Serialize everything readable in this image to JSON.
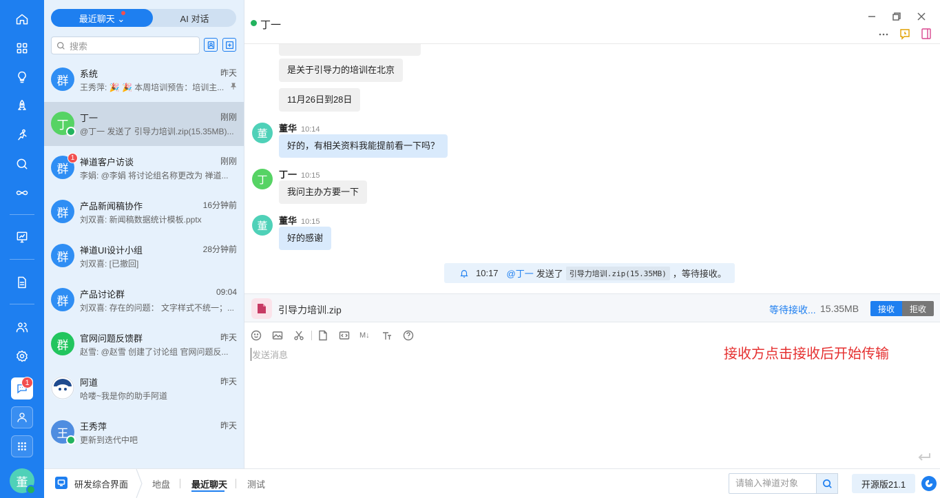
{
  "colors": {
    "brand": "#1e7ff0",
    "online": "#22b35e",
    "badge": "#f24f4f",
    "annotation": "#e53030"
  },
  "panel": {
    "tabs": [
      {
        "label": "最近聊天 ⌄"
      },
      {
        "label": "AI 对话"
      }
    ],
    "search_placeholder": "搜索",
    "sessions": [
      {
        "avatar": "群",
        "color": "#2f8ef4",
        "name": "系统",
        "time": "昨天",
        "snippet": "王秀萍: 🎉 🎉 本周培训预告：培训主...",
        "pinned": true
      },
      {
        "avatar": "丁",
        "color": "#56d364",
        "name": "丁一",
        "time": "刚刚",
        "snippet": "@丁一 发送了 引导力培训.zip(15.35MB)...",
        "online": true,
        "active": true
      },
      {
        "avatar": "群",
        "color": "#2f8ef4",
        "name": "禅道客户访谈",
        "time": "刚刚",
        "snippet": "李娟: @李娟 将讨论组名称更改为 禅道...",
        "badge": "1"
      },
      {
        "avatar": "群",
        "color": "#2f8ef4",
        "name": "产品新闻稿协作",
        "time": "16分钟前",
        "snippet": "刘双喜: 新闻稿数据统计模板.pptx"
      },
      {
        "avatar": "群",
        "color": "#2f8ef4",
        "name": "禅道UI设计小组",
        "time": "28分钟前",
        "snippet": "刘双喜: [已撤回]"
      },
      {
        "avatar": "群",
        "color": "#2f8ef4",
        "name": "产品讨论群",
        "time": "09:04",
        "snippet": "刘双喜: 存在的问题： 文字样式不统一；..."
      },
      {
        "avatar": "群",
        "color": "#22c55e",
        "name": "官网问题反馈群",
        "time": "昨天",
        "snippet": "赵雪: @赵雪 创建了讨论组 官网问题反..."
      },
      {
        "avatar": "",
        "color": "#ffffff",
        "name": "阿道",
        "time": "昨天",
        "snippet": "哈喽~我是你的助手阿道",
        "mascot": true
      },
      {
        "avatar": "王",
        "color": "#4f8de0",
        "name": "王秀萍",
        "time": "昨天",
        "snippet": "更新到迭代中吧",
        "online": true
      }
    ]
  },
  "rail": {
    "chat_badge": "1",
    "user_avatar": "董"
  },
  "chat": {
    "title": "丁一",
    "messages": [
      {
        "kind": "bubble",
        "text": "是关于引导力的培训在北京"
      },
      {
        "kind": "bubble",
        "text": "11月26日到28日"
      },
      {
        "kind": "sender",
        "avatar": "董",
        "name": "董华",
        "time": "10:14",
        "text": "好的，有相关资料我能提前看一下吗？",
        "blue": true
      },
      {
        "kind": "sender",
        "avatar": "丁",
        "name": "丁一",
        "time": "10:15",
        "text": "我问主办方要一下",
        "blue": false
      },
      {
        "kind": "sender",
        "avatar": "董",
        "name": "董华",
        "time": "10:15",
        "text": "好的感谢",
        "blue": true
      }
    ],
    "notice": {
      "time": "10:17",
      "mention": "@丁一",
      "action": "发送了",
      "file": "引导力培训.zip(15.35MB)",
      "suffix": "，等待接收。"
    }
  },
  "file": {
    "name": "引导力培训.zip",
    "status": "等待接收...",
    "size": "15.35MB",
    "accept_label": "接收",
    "reject_label": "拒收"
  },
  "editor": {
    "placeholder": "发送消息",
    "markdown_label": "M↓",
    "annotation": "接收方点击接收后开始传输"
  },
  "statusbar": {
    "app_label": "研发综合界面",
    "crumbs": [
      "地盘",
      "最近聊天",
      "测试"
    ],
    "search_placeholder": "请输入禅道对象",
    "version": "开源版21.1"
  }
}
